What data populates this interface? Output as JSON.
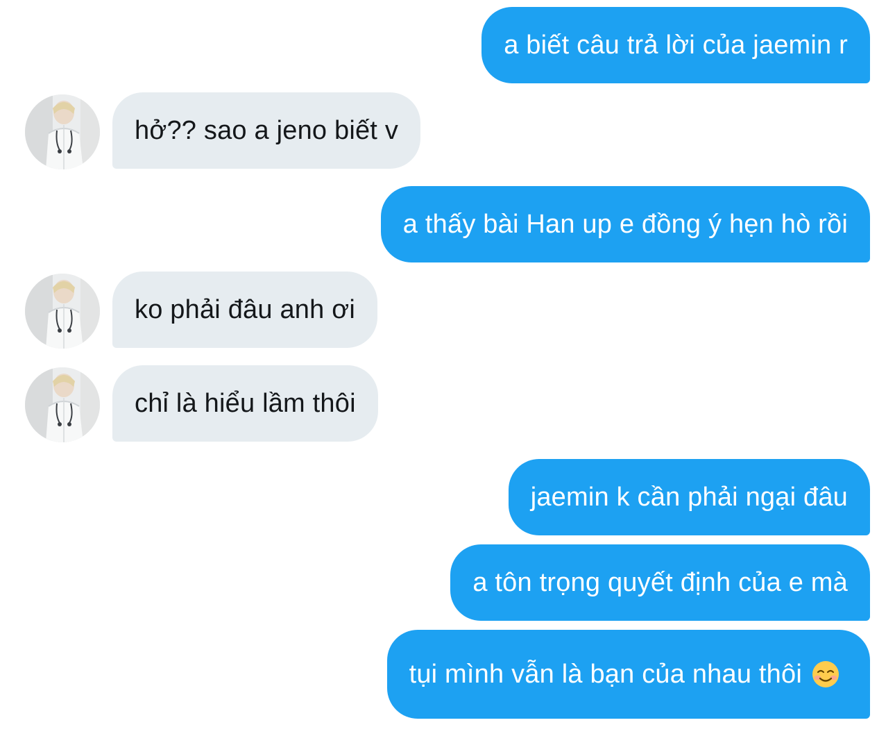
{
  "colors": {
    "outgoing_bubble": "#1da1f2",
    "incoming_bubble": "#e6ecf0",
    "outgoing_text": "#ffffff",
    "incoming_text": "#14171a"
  },
  "messages": [
    {
      "direction": "out",
      "text": "a biết câu trả lời của jaemin r"
    },
    {
      "direction": "in",
      "text": "hở?? sao a jeno biết v",
      "avatar": "contact-avatar"
    },
    {
      "direction": "out",
      "text": "a thấy bài Han up e đồng ý hẹn hò rồi"
    },
    {
      "direction": "in",
      "text": "ko phải đâu anh ơi",
      "avatar": "contact-avatar"
    },
    {
      "direction": "in",
      "text": "chỉ là hiểu lầm thôi",
      "avatar": "contact-avatar"
    },
    {
      "direction": "out",
      "text": "jaemin k cần phải ngại đâu"
    },
    {
      "direction": "out",
      "text": "a tôn trọng quyết định của e mà"
    },
    {
      "direction": "out",
      "text": "tụi mình vẫn là bạn của nhau thôi",
      "emoji": "smiling-face-icon"
    }
  ]
}
